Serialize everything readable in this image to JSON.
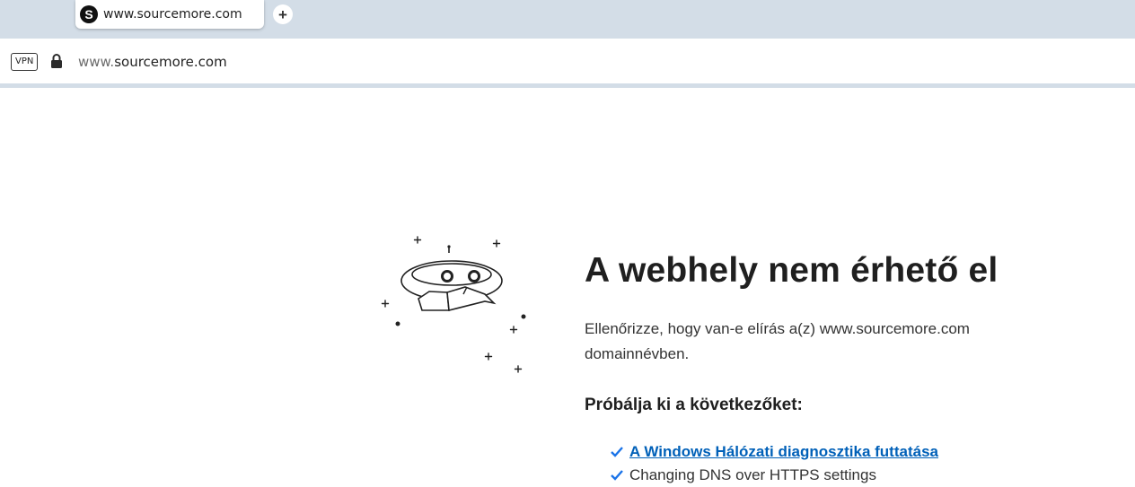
{
  "tab": {
    "favicon_letter": "S",
    "title": "www.sourcemore.com",
    "new_tab_icon": "plus-icon"
  },
  "addressbar": {
    "vpn_label": "VPN",
    "lock_icon": "lock-icon",
    "url_prefix": "www.",
    "url_domain": "sourcemore.com"
  },
  "error_page": {
    "heading": "A webhely nem érhető el",
    "description": "Ellenőrizze, hogy van-e elírás a(z) www.sourcemore.com domainnévben.",
    "try_title": "Próbálja ki a következőket:",
    "suggestions": [
      {
        "label": "A Windows Hálózati diagnosztika futtatása"
      },
      {
        "label": "Changing DNS over HTTPS settings"
      }
    ]
  },
  "colors": {
    "chrome_background": "#d3dde7",
    "link": "#0060b8",
    "check": "#1a73e8"
  }
}
